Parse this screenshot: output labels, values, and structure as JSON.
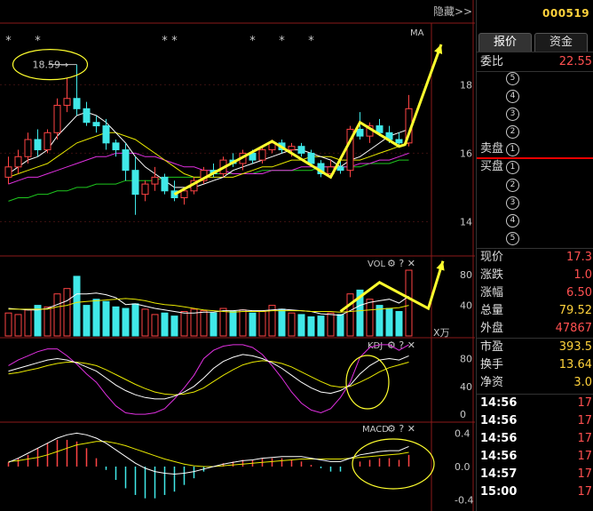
{
  "toolbar": {
    "hide_label": "隐藏>>"
  },
  "main_panel": {
    "ma_label": "MA",
    "star_marker": "*",
    "high_annotation": "18.59",
    "axis_ticks": [
      "18",
      "16",
      "14"
    ]
  },
  "vol_panel": {
    "label": "VOL",
    "axis_ticks": [
      "80",
      "40"
    ],
    "unit": "X万"
  },
  "kdj_panel": {
    "label": "KDJ",
    "axis_ticks": [
      "80",
      "40",
      "0"
    ]
  },
  "macd_panel": {
    "label": "MACD",
    "axis_ticks": [
      "0.4",
      "0.0",
      "-0.4"
    ]
  },
  "quote": {
    "code": "000519",
    "tabs": [
      "报价",
      "资金"
    ],
    "weibi_label": "委比",
    "weibi_value": "22.55",
    "sell_label": "卖盘",
    "buy_label": "买盘",
    "levels": [
      "5",
      "4",
      "3",
      "2",
      "1"
    ],
    "stats": [
      {
        "label": "现价",
        "value": "17.3"
      },
      {
        "label": "涨跌",
        "value": "1.0"
      },
      {
        "label": "涨幅",
        "value": "6.50"
      },
      {
        "label": "总量",
        "value": "79.52"
      },
      {
        "label": "外盘",
        "value": "47867"
      },
      {
        "label": "市盈",
        "value": "393.5"
      },
      {
        "label": "换手",
        "value": "13.64"
      },
      {
        "label": "净资",
        "value": "3.0"
      }
    ],
    "ticks": [
      {
        "time": "14:56",
        "price": "17"
      },
      {
        "time": "14:56",
        "price": "17"
      },
      {
        "time": "14:56",
        "price": "17"
      },
      {
        "time": "14:56",
        "price": "17"
      },
      {
        "time": "14:57",
        "price": "17"
      },
      {
        "time": "15:00",
        "price": "17"
      }
    ]
  },
  "colors": {
    "up": "#ff4444",
    "down": "#40e8e8",
    "annot": "#ffff2e"
  },
  "chart_data": {
    "type": "candlestick",
    "candles": [
      [
        15.3,
        15.9,
        15.1,
        15.6
      ],
      [
        15.6,
        16.1,
        15.4,
        15.9
      ],
      [
        15.9,
        16.6,
        15.7,
        16.4
      ],
      [
        16.4,
        16.7,
        15.9,
        16.1
      ],
      [
        16.1,
        16.7,
        16.0,
        16.6
      ],
      [
        16.6,
        17.6,
        16.4,
        17.4
      ],
      [
        17.4,
        18.2,
        17.2,
        17.6
      ],
      [
        17.6,
        18.59,
        17.1,
        17.3
      ],
      [
        17.3,
        17.5,
        16.8,
        16.9
      ],
      [
        16.9,
        17.1,
        16.6,
        16.8
      ],
      [
        16.8,
        17.0,
        16.1,
        16.3
      ],
      [
        16.3,
        16.4,
        15.9,
        16.1
      ],
      [
        16.1,
        16.3,
        15.2,
        15.5
      ],
      [
        15.5,
        15.9,
        14.2,
        14.8
      ],
      [
        14.8,
        15.2,
        14.6,
        15.1
      ],
      [
        15.1,
        15.6,
        14.9,
        15.3
      ],
      [
        15.3,
        15.4,
        14.8,
        14.9
      ],
      [
        14.9,
        15.2,
        14.6,
        14.7
      ],
      [
        14.7,
        15.0,
        14.5,
        14.9
      ],
      [
        14.9,
        15.3,
        14.8,
        15.2
      ],
      [
        15.2,
        15.6,
        15.1,
        15.5
      ],
      [
        15.5,
        15.7,
        15.3,
        15.4
      ],
      [
        15.4,
        15.9,
        15.3,
        15.8
      ],
      [
        15.8,
        16.0,
        15.6,
        15.7
      ],
      [
        15.7,
        16.1,
        15.5,
        16.0
      ],
      [
        16.0,
        16.1,
        15.7,
        15.8
      ],
      [
        15.8,
        16.2,
        15.7,
        16.1
      ],
      [
        16.1,
        16.4,
        16.0,
        16.3
      ],
      [
        16.3,
        16.4,
        16.0,
        16.1
      ],
      [
        16.1,
        16.3,
        15.9,
        16.2
      ],
      [
        16.2,
        16.3,
        15.9,
        16.0
      ],
      [
        16.0,
        16.1,
        15.6,
        15.7
      ],
      [
        15.7,
        15.8,
        15.3,
        15.4
      ],
      [
        15.4,
        15.8,
        15.3,
        15.6
      ],
      [
        15.6,
        15.9,
        15.4,
        15.5
      ],
      [
        15.5,
        16.8,
        15.3,
        16.7
      ],
      [
        16.7,
        17.2,
        16.4,
        16.5
      ],
      [
        16.5,
        16.9,
        16.3,
        16.8
      ],
      [
        16.8,
        17.0,
        16.5,
        16.6
      ],
      [
        16.6,
        16.8,
        16.3,
        16.4
      ],
      [
        16.4,
        16.6,
        16.2,
        16.3
      ],
      [
        16.3,
        17.7,
        16.2,
        17.3
      ]
    ],
    "ma5": [
      15.4,
      15.6,
      15.8,
      15.9,
      16.1,
      16.5,
      16.8,
      17.1,
      17.2,
      17.1,
      16.9,
      16.6,
      16.3,
      15.9,
      15.6,
      15.4,
      15.2,
      15.0,
      15.0,
      15.0,
      15.1,
      15.2,
      15.3,
      15.5,
      15.6,
      15.7,
      15.8,
      15.9,
      16.0,
      16.1,
      16.1,
      16.0,
      15.9,
      15.8,
      15.6,
      15.8,
      15.9,
      16.1,
      16.3,
      16.5,
      16.6,
      16.7
    ],
    "ma10": [
      15.3,
      15.4,
      15.5,
      15.6,
      15.7,
      15.9,
      16.1,
      16.3,
      16.4,
      16.5,
      16.6,
      16.6,
      16.5,
      16.4,
      16.2,
      16.0,
      15.8,
      15.6,
      15.4,
      15.3,
      15.3,
      15.3,
      15.3,
      15.3,
      15.4,
      15.5,
      15.6,
      15.6,
      15.7,
      15.8,
      15.8,
      15.9,
      15.9,
      15.9,
      15.8,
      15.8,
      15.8,
      15.9,
      16.0,
      16.1,
      16.2,
      16.3
    ],
    "ma20": [
      15.1,
      15.2,
      15.3,
      15.3,
      15.4,
      15.5,
      15.6,
      15.7,
      15.8,
      15.9,
      15.9,
      16.0,
      16.0,
      16.0,
      15.9,
      15.9,
      15.8,
      15.7,
      15.6,
      15.6,
      15.5,
      15.5,
      15.5,
      15.4,
      15.4,
      15.4,
      15.4,
      15.5,
      15.5,
      15.5,
      15.6,
      15.6,
      15.6,
      15.6,
      15.6,
      15.6,
      15.7,
      15.7,
      15.8,
      15.8,
      15.9,
      16.0
    ],
    "ma60": [
      14.6,
      14.7,
      14.7,
      14.8,
      14.8,
      14.9,
      14.9,
      15.0,
      15.0,
      15.1,
      15.1,
      15.1,
      15.2,
      15.2,
      15.2,
      15.2,
      15.3,
      15.3,
      15.3,
      15.3,
      15.3,
      15.4,
      15.4,
      15.4,
      15.4,
      15.4,
      15.5,
      15.5,
      15.5,
      15.5,
      15.5,
      15.5,
      15.6,
      15.6,
      15.6,
      15.6,
      15.6,
      15.7,
      15.7,
      15.7,
      15.8,
      15.8
    ],
    "volume": [
      30,
      28,
      34,
      40,
      38,
      55,
      62,
      78,
      40,
      48,
      45,
      38,
      36,
      42,
      35,
      28,
      30,
      26,
      32,
      35,
      33,
      30,
      36,
      32,
      34,
      30,
      32,
      40,
      35,
      30,
      28,
      25,
      26,
      30,
      28,
      55,
      60,
      48,
      40,
      36,
      32,
      86
    ],
    "vol_ma5": [
      36,
      35,
      34,
      34,
      36,
      41,
      46,
      55,
      55,
      56,
      54,
      50,
      41,
      42,
      39,
      36,
      34,
      32,
      30,
      30,
      31,
      31,
      33,
      33,
      34,
      33,
      33,
      34,
      35,
      34,
      33,
      32,
      29,
      28,
      27,
      33,
      40,
      44,
      46,
      48,
      43,
      52
    ],
    "vol_ma10": [
      35,
      35,
      35,
      35,
      35,
      38,
      40,
      44,
      45,
      46,
      47,
      48,
      49,
      48,
      46,
      43,
      41,
      40,
      38,
      36,
      34,
      33,
      32,
      31,
      32,
      32,
      32,
      33,
      33,
      33,
      33,
      32,
      32,
      32,
      31,
      32,
      33,
      34,
      35,
      36,
      37,
      40
    ],
    "kdj_k": [
      62,
      66,
      70,
      74,
      78,
      80,
      78,
      74,
      68,
      62,
      52,
      42,
      34,
      28,
      24,
      22,
      22,
      26,
      32,
      40,
      52,
      66,
      76,
      82,
      86,
      84,
      80,
      74,
      66,
      56,
      46,
      38,
      32,
      30,
      34,
      42,
      58,
      70,
      78,
      80,
      78,
      84
    ],
    "kdj_d": [
      58,
      60,
      63,
      66,
      70,
      73,
      75,
      75,
      73,
      70,
      64,
      57,
      50,
      43,
      37,
      32,
      29,
      28,
      29,
      32,
      38,
      47,
      56,
      64,
      71,
      75,
      77,
      76,
      73,
      68,
      61,
      54,
      47,
      41,
      39,
      40,
      46,
      53,
      61,
      67,
      71,
      75
    ],
    "kdj_j": [
      70,
      78,
      84,
      90,
      94,
      94,
      84,
      72,
      58,
      46,
      28,
      12,
      2,
      0,
      0,
      2,
      8,
      22,
      38,
      56,
      80,
      92,
      98,
      100,
      100,
      96,
      86,
      70,
      52,
      32,
      16,
      6,
      2,
      8,
      24,
      46,
      82,
      96,
      100,
      100,
      92,
      100
    ],
    "macd_dif": [
      0.05,
      0.1,
      0.16,
      0.22,
      0.28,
      0.34,
      0.38,
      0.4,
      0.38,
      0.34,
      0.28,
      0.2,
      0.12,
      0.04,
      -0.02,
      -0.06,
      -0.08,
      -0.09,
      -0.08,
      -0.06,
      -0.03,
      0.0,
      0.03,
      0.05,
      0.07,
      0.08,
      0.1,
      0.11,
      0.12,
      0.12,
      0.12,
      0.1,
      0.08,
      0.06,
      0.06,
      0.1,
      0.14,
      0.16,
      0.18,
      0.19,
      0.19,
      0.24
    ],
    "macd_dea": [
      0.06,
      0.07,
      0.09,
      0.11,
      0.14,
      0.18,
      0.22,
      0.26,
      0.28,
      0.3,
      0.3,
      0.28,
      0.25,
      0.21,
      0.17,
      0.13,
      0.09,
      0.06,
      0.03,
      0.01,
      0.0,
      0.0,
      0.01,
      0.02,
      0.03,
      0.04,
      0.05,
      0.06,
      0.07,
      0.08,
      0.09,
      0.09,
      0.09,
      0.09,
      0.09,
      0.1,
      0.11,
      0.12,
      0.13,
      0.14,
      0.15,
      0.17
    ],
    "macd_hist": [
      0.05,
      0.1,
      0.14,
      0.22,
      0.28,
      0.32,
      0.32,
      0.3,
      0.22,
      0.1,
      -0.04,
      -0.16,
      -0.26,
      -0.34,
      -0.38,
      -0.38,
      -0.34,
      -0.3,
      -0.22,
      -0.14,
      -0.06,
      0.0,
      0.04,
      0.06,
      0.08,
      0.08,
      0.1,
      0.1,
      0.1,
      0.08,
      0.06,
      0.02,
      -0.02,
      -0.06,
      -0.06,
      0.0,
      0.06,
      0.08,
      0.1,
      0.1,
      0.08,
      0.14
    ],
    "star_candles": [
      0,
      3,
      16,
      17,
      25,
      28,
      31
    ]
  }
}
